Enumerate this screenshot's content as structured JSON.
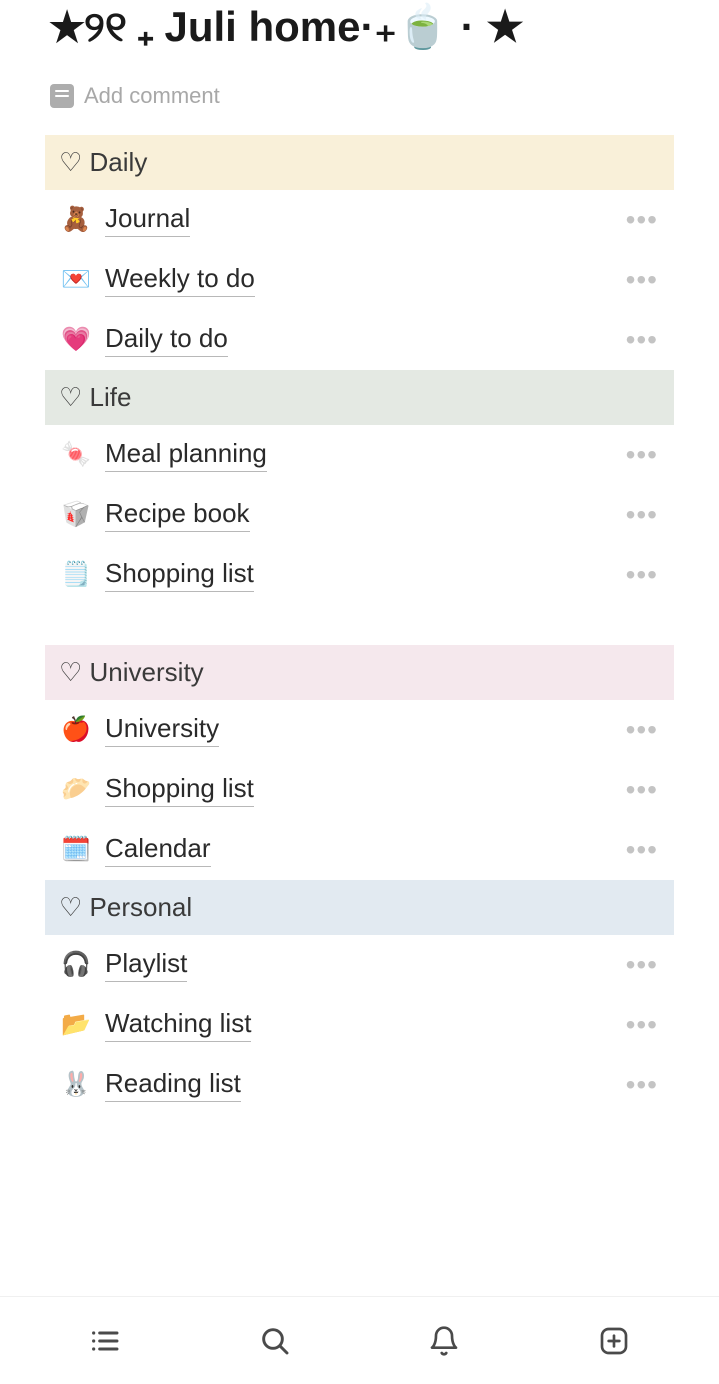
{
  "page_title": "★୨୧ ₊ Juli home·₊🍵 · ★",
  "add_comment_label": "Add comment",
  "sections": [
    {
      "id": "daily",
      "heading": "♡ Daily",
      "color_class": "section-daily",
      "items": [
        {
          "emoji": "🧸",
          "label": "Journal"
        },
        {
          "emoji": "💌",
          "label": "Weekly to do"
        },
        {
          "emoji": "💗",
          "label": "Daily to do"
        }
      ],
      "gap_after": false
    },
    {
      "id": "life",
      "heading": "♡ Life",
      "color_class": "section-life",
      "items": [
        {
          "emoji": "🍬",
          "label": "Meal planning"
        },
        {
          "emoji": "🥡",
          "label": "Recipe book"
        },
        {
          "emoji": "🗒️",
          "label": "Shopping list"
        }
      ],
      "gap_after": true
    },
    {
      "id": "university",
      "heading": "♡ University",
      "color_class": "section-university",
      "items": [
        {
          "emoji": "🍎",
          "label": "University"
        },
        {
          "emoji": "🥟",
          "label": "Shopping list"
        },
        {
          "emoji": "🗓️",
          "label": "Calendar"
        }
      ],
      "gap_after": false
    },
    {
      "id": "personal",
      "heading": "♡ Personal",
      "color_class": "section-personal",
      "items": [
        {
          "emoji": "🎧",
          "label": "Playlist"
        },
        {
          "emoji": "📂",
          "label": "Watching list"
        },
        {
          "emoji": "🐰",
          "label": "Reading list"
        }
      ],
      "gap_after": false
    }
  ],
  "bottom_nav": {
    "list_icon": "list",
    "search_icon": "search",
    "notifications_icon": "bell",
    "add_icon": "plus"
  }
}
